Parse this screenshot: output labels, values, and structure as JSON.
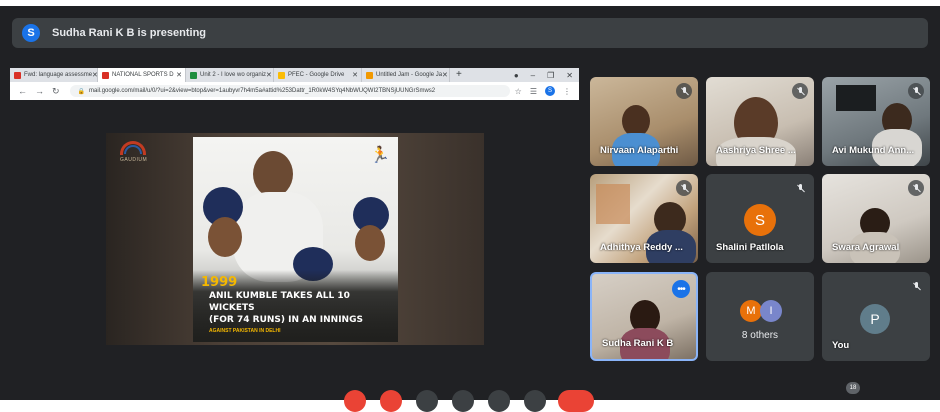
{
  "banner": {
    "avatar_letter": "S",
    "text": "Sudha Rani K B is presenting"
  },
  "browser": {
    "tabs": [
      {
        "label": "Fwd: language assessme",
        "color": "#d93025"
      },
      {
        "label": "NATIONAL SPORTS D",
        "color": "#d93025"
      },
      {
        "label": "Unit 2 - I love wo organiz",
        "color": "#1e8e3e"
      },
      {
        "label": "PFEC - Google Drive",
        "color": "#fbbc04"
      },
      {
        "label": "Untitled Jam - Google Ja",
        "color": "#f29900"
      }
    ],
    "new_tab": "+",
    "url": "mail.google.com/mail/u/0/?ui=2&view=btop&ver=1aubyvr7h4m5a#attid%253Dattr_1R0kW4SYq4NbWUQWI2TBNSjUUNGrSmws2",
    "profile_letter": "S"
  },
  "slide": {
    "logo_text": "GAUDIUM",
    "year": "1999",
    "headline_1": "ANIL KUMBLE TAKES ALL 10 WICKETS",
    "headline_2": "(FOR 74 RUNS) IN AN INNINGS",
    "subline": "AGAINST PAKISTAN IN DELHI"
  },
  "participants": [
    {
      "name": "Nirvaan Alaparthi"
    },
    {
      "name": "Aashriya Shree ..."
    },
    {
      "name": "Avi Mukund Ann..."
    },
    {
      "name": "Adhithya Reddy ..."
    },
    {
      "name": "Shalini Patllola",
      "avatar": "S",
      "avatar_color": "#e8710a"
    },
    {
      "name": "Swara Agrawal"
    },
    {
      "name": "Sudha Rani K B"
    },
    {
      "name": "8 others",
      "avatars": [
        "M",
        "I"
      ],
      "avatar_colors": [
        "#e8710a",
        "#7986cb"
      ]
    },
    {
      "name": "You",
      "avatar": "P",
      "avatar_color": "#607d8b"
    }
  ],
  "controls": {
    "participant_count": "18"
  },
  "colors": {
    "bg": "#202124",
    "banner": "#3c4043",
    "tile": "#3c4043",
    "accent": "#1a73e8",
    "end_call": "#ea4335"
  }
}
